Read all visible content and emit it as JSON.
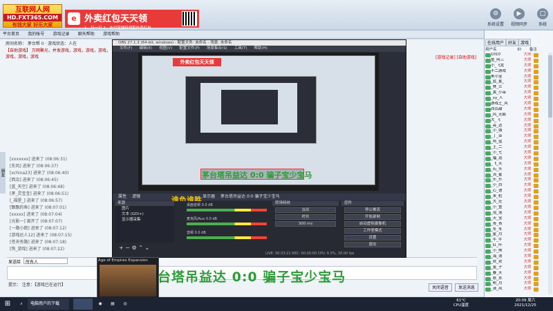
{
  "app": {
    "logo_line1": "互联网人网",
    "logo_line2": "HD.FXT365.COM",
    "logo_line3": "有钱大家 好乐大家",
    "banner_title": "外卖红包天天领",
    "banner_sub": "1、扫一扫    2、支付宝搜码领取外卖红包",
    "banner_badge": "e"
  },
  "top_icons": [
    {
      "label": "系统设置",
      "icon": "gear-icon"
    },
    {
      "label": "视频同步",
      "icon": "video-icon"
    },
    {
      "label": "系统",
      "icon": "window-icon"
    }
  ],
  "nav": [
    "平台首页",
    "我的帐号",
    "游戏记录",
    "聊天帮助",
    "游戏帮助"
  ],
  "left": {
    "header": "房间名称：  茅台帮 II  ·  游戏状态：人在",
    "title": "【自助游戏】 万网聚光，并发游戏，游戏，游戏，游戏，游戏，游戏，游戏",
    "notice": "[游戏记录] [自助游戏]",
    "chat_lines": [
      "[xxxxxxx] 进来了 (08:06:31)",
      "[东风] 进来了 (08:06:37)",
      "[xchina23] 进来了 (08:06:40)",
      "[西瓜] 进来了 (08:06:45)",
      "[蓝_天空] 进来了 (08:06:48)",
      "[茅_灵宝宝] 进来了 (08:06:51)",
      "[_福星_] 进来了 (08:06:57)",
      "[飘飘的鱼] 进来了 (08:07:01)",
      "[xxxxx] 进来了 (08:07:04)",
      "[光影一] 离开了 (08:07:07)",
      "[一路小跑] 进来了 (08:07:12)",
      "[游戏达人12] 进来了 (08:07:15)",
      "[苍天有路] 进来了 (08:07:18)",
      "[狗_游戏] 进来了 (08:07:22)",
      "[小蜜蜂] 进来了 (08:07:25)"
    ],
    "side_tab": "朋友"
  },
  "input": {
    "label": "发送给",
    "value": "所有人",
    "status": "提示：  注意：【游戏已在运行】",
    "close_btn": "关闭语音",
    "send_btn": "发送消息"
  },
  "right": {
    "tabs": [
      "在线用户",
      "好友",
      "游戏"
    ],
    "cols": [
      "用户名",
      "ID",
      "备注"
    ],
    "users": [
      "1010",
      "鱼_阿三",
      "小_飞龙",
      "不二游戏",
      "朱小宝",
      "_蓝_星_",
      "_林_兰",
      "_黄_小朵",
      "_xy_人",
      "游戏王_风",
      "西瓜甜",
      "_风_无痕",
      "大_飞",
      "_亮_达",
      "_小_强",
      "_丁_亚",
      "_阿_蓝",
      "_王_二",
      "_小_七",
      "_福_运",
      "_飞_天",
      "_石_头",
      "_流_星",
      "_乐_乐",
      "_小_白",
      "_心_语",
      "_米_粒",
      "_大_壮",
      "_小_鱼",
      "_泡_泡",
      "_天_宝",
      "_青_青",
      "_冬_冬",
      "_星_月",
      "_牛_牛",
      "_红_叶",
      "_小_熊",
      "_海_浪",
      "_欢_欢",
      "_金_子",
      "_春_天",
      "_秋_水",
      "_明_月",
      "_清_风"
    ],
    "rank_label": "大师"
  },
  "obs": {
    "title": "OBS 27.1.3 (64-bit, windows) - 配置文件: 未命名 - 场景: 未命名",
    "menu": [
      "文件(F)",
      "编辑(E)",
      "视图(V)",
      "配置文件(P)",
      "场景集合(S)",
      "工具(T)",
      "帮助(H)"
    ],
    "overlay_small": "茅台塔吊益达 0:0 骗子宝少宝马",
    "winner_text": "谁负谁胜",
    "bar_items": [
      "属性",
      "滤镜",
      "显示器",
      "茅台塔吊益达 0:0 骗子宝少宝马"
    ],
    "sources_title": "来源",
    "sources": [
      "图片",
      "文本 (GDI+)",
      "显示器采集"
    ],
    "mixer": [
      {
        "name": "桌面音频",
        "db": "0.0 dB"
      },
      {
        "name": "麦克风/Aux",
        "db": "0.0 dB"
      },
      {
        "name": "音频",
        "db": "0.0 dB"
      }
    ],
    "transition_title": "转场特效",
    "transition_value": "淡出",
    "transition_duration_label": "时长",
    "transition_duration": "300 ms",
    "controls_title": "控件",
    "controls": [
      "停止推流",
      "开始录制",
      "启动虚拟摄像机",
      "工作室模式",
      "设置",
      "退出"
    ],
    "status": "LIVE: 00:33:21   REC: 00:00:00   CPU: 6.5%, 30.00 fps"
  },
  "overlay_text": "茅台塔吊益达 0:0 骗子宝少宝马",
  "preview_window": {
    "title": "Age of Empires Expansion"
  },
  "taskbar": {
    "search": "电脑用户的下载",
    "app1": "",
    "temp": "61°C",
    "cpu": "CPU温度",
    "time": "20:09 周六",
    "date": "2021/12/25"
  },
  "colors": {
    "accent_red": "#e93a3a",
    "overlay_green": "#2d9b3a",
    "winner_yellow": "#f1c40f"
  }
}
